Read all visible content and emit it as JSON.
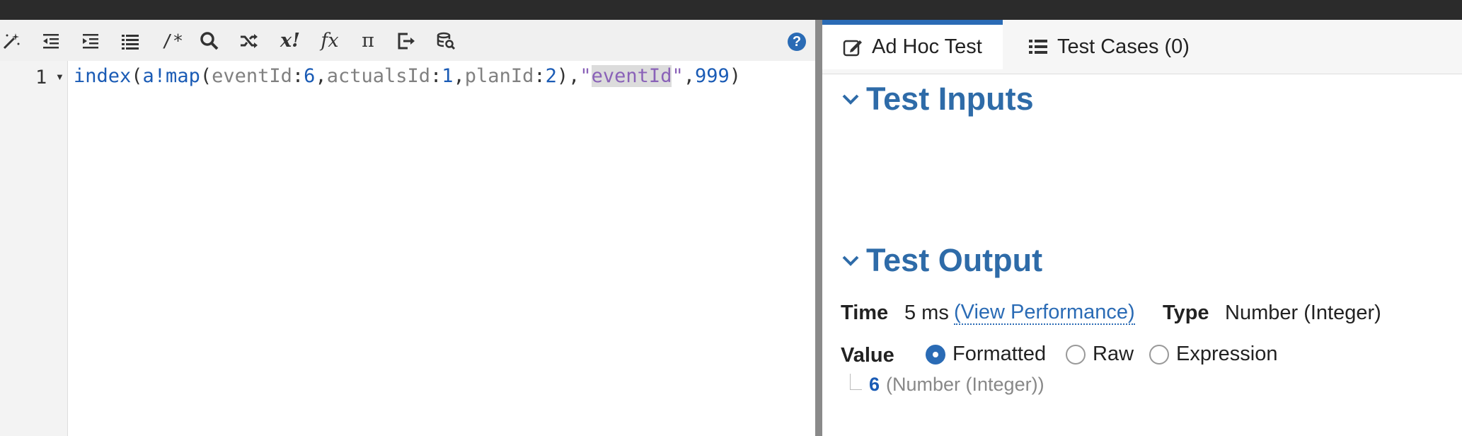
{
  "editor": {
    "toolbar": {
      "icons": [
        {
          "name": "magic-wand-icon",
          "label": ""
        },
        {
          "name": "outdent-icon",
          "label": ""
        },
        {
          "name": "indent-icon",
          "label": ""
        },
        {
          "name": "format-list-icon",
          "label": ""
        },
        {
          "name": "comment-icon",
          "label": "/*"
        },
        {
          "name": "search-icon",
          "label": ""
        },
        {
          "name": "shuffle-icon",
          "label": ""
        },
        {
          "name": "rule-input-icon",
          "label": "x!"
        },
        {
          "name": "function-icon",
          "label": "fx"
        },
        {
          "name": "constant-pi-icon",
          "label": "π"
        },
        {
          "name": "export-icon",
          "label": ""
        },
        {
          "name": "database-search-icon",
          "label": ""
        }
      ],
      "help_label": "?"
    },
    "line_number": "1",
    "fold_arrow": "▼",
    "code_tokens": [
      {
        "text": "index",
        "cls": "c-fn"
      },
      {
        "text": "(",
        "cls": "c-punc"
      },
      {
        "text": "a!map",
        "cls": "c-fn2"
      },
      {
        "text": "(",
        "cls": "c-punc"
      },
      {
        "text": "eventId",
        "cls": "c-key"
      },
      {
        "text": ":",
        "cls": "c-punc"
      },
      {
        "text": "6",
        "cls": "c-num"
      },
      {
        "text": ",",
        "cls": "c-punc"
      },
      {
        "text": "actualsId",
        "cls": "c-key"
      },
      {
        "text": ":",
        "cls": "c-punc"
      },
      {
        "text": "1",
        "cls": "c-num"
      },
      {
        "text": ",",
        "cls": "c-punc"
      },
      {
        "text": "planId",
        "cls": "c-key"
      },
      {
        "text": ":",
        "cls": "c-punc"
      },
      {
        "text": "2",
        "cls": "c-num"
      },
      {
        "text": "),",
        "cls": "c-punc"
      },
      {
        "text": "\"",
        "cls": "c-str"
      },
      {
        "text": "eventId",
        "cls": "c-str-hl"
      },
      {
        "text": "\"",
        "cls": "c-str"
      },
      {
        "text": ",",
        "cls": "c-punc"
      },
      {
        "text": "999",
        "cls": "c-num"
      },
      {
        "text": ")",
        "cls": "c-punc"
      }
    ]
  },
  "tabs": [
    {
      "label": "Ad Hoc Test",
      "icon": "edit-icon",
      "active": true
    },
    {
      "label": "Test Cases (0)",
      "icon": "list-icon",
      "active": false
    }
  ],
  "test_inputs": {
    "title": "Test Inputs"
  },
  "test_output": {
    "title": "Test Output",
    "time_label": "Time",
    "time_value": "5 ms",
    "view_performance": "(View Performance)",
    "type_label": "Type",
    "type_value": "Number (Integer)",
    "value_label": "Value",
    "radio_options": [
      {
        "label": "Formatted",
        "checked": true
      },
      {
        "label": "Raw",
        "checked": false
      },
      {
        "label": "Expression",
        "checked": false
      }
    ],
    "result_value": "6",
    "result_type": "(Number (Integer))"
  },
  "colors": {
    "accent": "#2a6bb5",
    "heading": "#2e6ba8",
    "topbar": "#2b2b2b",
    "splitter": "#8a8a8a"
  }
}
